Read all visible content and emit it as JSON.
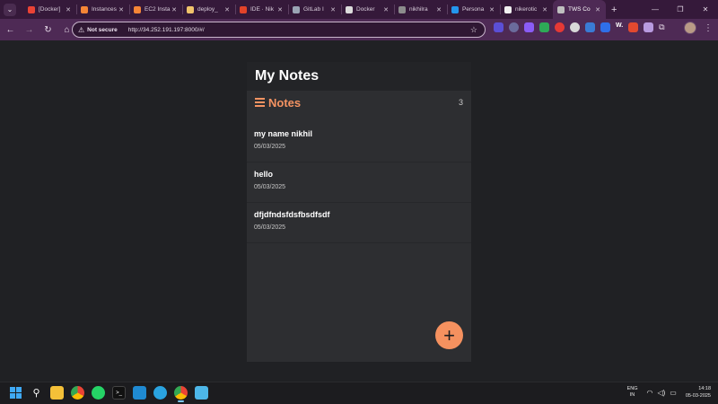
{
  "browser": {
    "tabs": [
      {
        "title": "[Docker]",
        "icon": "gmail-icon",
        "color": "#ea4335"
      },
      {
        "title": "Instances",
        "icon": "aws-icon",
        "color": "#f58536"
      },
      {
        "title": "EC2 Insta",
        "icon": "aws-icon",
        "color": "#f58536"
      },
      {
        "title": "deploy_",
        "icon": "app-icon",
        "color": "#f0c36b"
      },
      {
        "title": "IDE · Nik",
        "icon": "gitlab-icon",
        "color": "#e24329"
      },
      {
        "title": "GitLab I",
        "icon": "gitlab-icon",
        "color": "#9aa4b4"
      },
      {
        "title": "Docker",
        "icon": "docker-icon",
        "color": "#dcdcdc"
      },
      {
        "title": "nikhilra",
        "icon": "github-icon",
        "color": "#8c8c8c"
      },
      {
        "title": "Persona",
        "icon": "docker-icon",
        "color": "#2496ed"
      },
      {
        "title": "nikerotic",
        "icon": "github-icon",
        "color": "#f0f0f0"
      },
      {
        "title": "TWS Co",
        "icon": "globe-icon",
        "color": "#bfbfbf",
        "active": true
      }
    ],
    "new_tab": "+",
    "omnibox": {
      "security": "Not secure",
      "url": "http://34.252.191.197:8000/#/"
    }
  },
  "app": {
    "title": "My Notes",
    "section_title": "Notes",
    "count": "3",
    "notes": [
      {
        "title": "my name nikhil",
        "date": "05/03/2025"
      },
      {
        "title": "hello",
        "date": "05/03/2025"
      },
      {
        "title": "dfjdfndsfdsfbsdfsdf",
        "date": "05/03/2025"
      }
    ],
    "fab_label": "+",
    "accent": "#f59362"
  },
  "taskbar": {
    "lang_line1": "ENG",
    "lang_line2": "IN",
    "time": "14:18",
    "date": "05-03-2025"
  }
}
